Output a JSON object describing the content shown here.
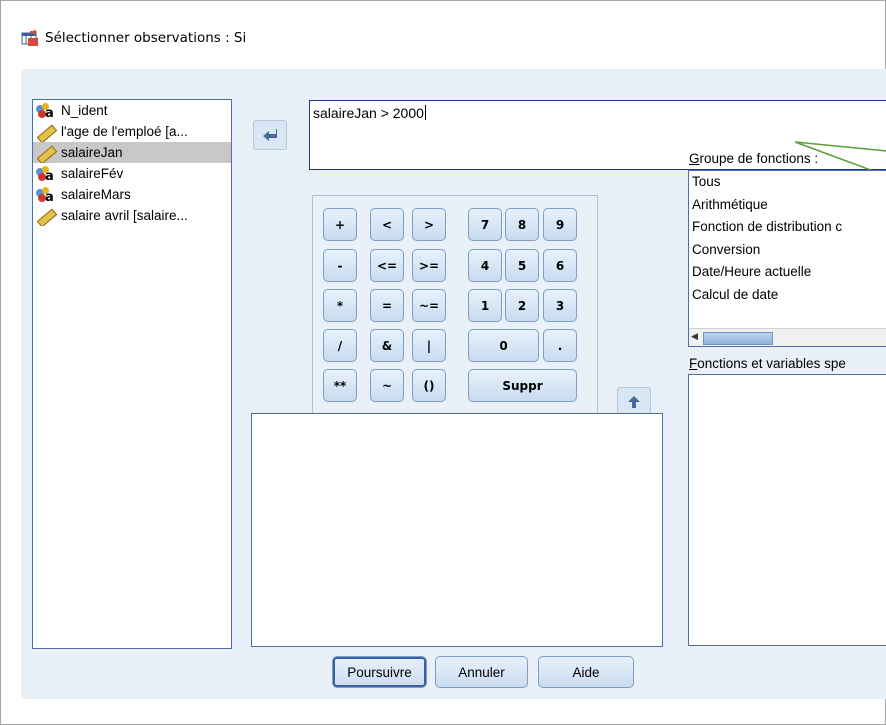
{
  "window": {
    "title": "Sélectionner observations : Si"
  },
  "variables": [
    {
      "label": "N_ident",
      "type": "nominal",
      "selected": false
    },
    {
      "label": "l'age de l'emploé [a...",
      "type": "scale",
      "selected": false
    },
    {
      "label": "salaireJan",
      "type": "scale",
      "selected": true
    },
    {
      "label": "salaireFév",
      "type": "nominal",
      "selected": false
    },
    {
      "label": "salaireMars",
      "type": "nominal",
      "selected": false
    },
    {
      "label": "salaire avril [salaire...",
      "type": "scale",
      "selected": false
    }
  ],
  "expression": {
    "value": "salaireJan > 2000"
  },
  "keypad": {
    "keys": [
      "+",
      "<",
      ">",
      "7",
      "8",
      "9",
      "-",
      "<=",
      ">=",
      "4",
      "5",
      "6",
      "*",
      "=",
      "~=",
      "1",
      "2",
      "3",
      "/",
      "&",
      "|",
      "0",
      ".",
      "**",
      "~",
      "()",
      "Suppr"
    ]
  },
  "function_group": {
    "label_prefix": "G",
    "label_rest": "roupe de fonctions :",
    "items": [
      "Tous",
      "Arithmétique",
      "Fonction de distribution c",
      "Conversion",
      "Date/Heure actuelle",
      "Calcul de date"
    ]
  },
  "functions_vars": {
    "label_prefix": "F",
    "label_rest": "onctions et variables spe"
  },
  "buttons": {
    "continue": "Poursuivre",
    "cancel": "Annuler",
    "help": "Aide"
  },
  "icons": {
    "move_left": "arrow-left-icon",
    "move_up": "arrow-up-icon"
  },
  "colors": {
    "accent": "#23328f",
    "client_bg": "#e9f0f8",
    "annotation_arrow": "#5a9e3a"
  }
}
